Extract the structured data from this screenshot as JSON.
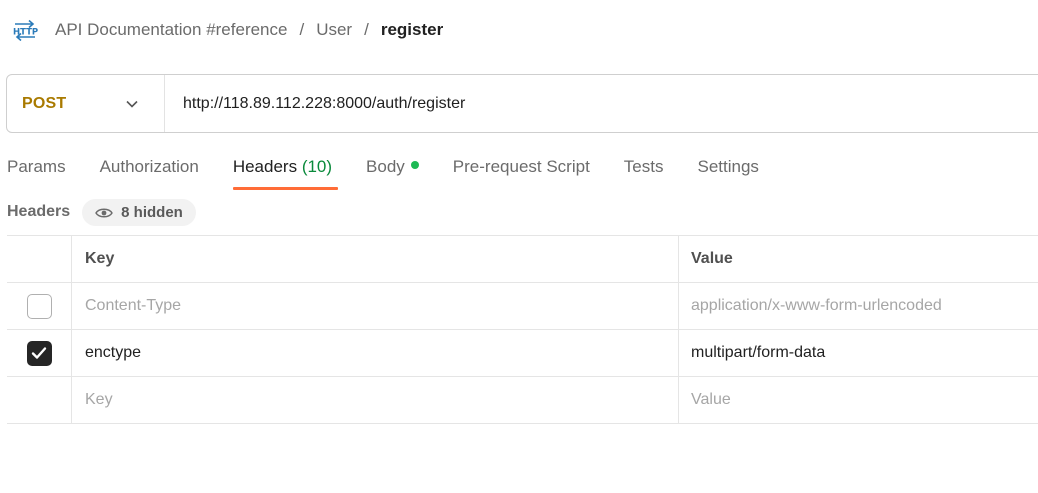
{
  "breadcrumb": {
    "icon": "http-request-icon",
    "items": [
      "API Documentation #reference",
      "User"
    ],
    "separator": "/",
    "current": "register"
  },
  "request": {
    "method": "POST",
    "url": "http://118.89.112.228:8000/auth/register"
  },
  "tabs": [
    {
      "label": "Params"
    },
    {
      "label": "Authorization"
    },
    {
      "label": "Headers",
      "count": "(10)",
      "active": true
    },
    {
      "label": "Body",
      "indicator": true
    },
    {
      "label": "Pre-request Script"
    },
    {
      "label": "Tests"
    },
    {
      "label": "Settings"
    }
  ],
  "headers_section": {
    "title": "Headers",
    "hidden_label": "8 hidden"
  },
  "table": {
    "columns": [
      "Key",
      "Value"
    ],
    "rows": [
      {
        "checked": false,
        "key": "Content-Type",
        "value": "application/x-www-form-urlencoded",
        "muted": true
      },
      {
        "checked": true,
        "key": "enctype",
        "value": "multipart/form-data",
        "muted": false
      }
    ],
    "placeholder": {
      "key": "Key",
      "value": "Value"
    }
  },
  "colors": {
    "method": "#a97a00",
    "active_tab_underline": "#ff6c37",
    "count": "#0a8a3b",
    "body_dot": "#1db954"
  }
}
